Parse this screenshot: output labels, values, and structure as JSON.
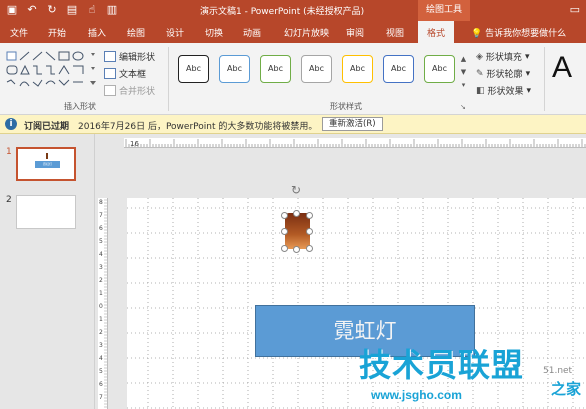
{
  "titlebar": {
    "title": "演示文稿1 - PowerPoint (未经授权产品)",
    "context_tab": "绘图工具",
    "qat": [
      "save-icon",
      "undo-icon",
      "redo-icon",
      "slideshow-icon",
      "touch-mode-icon",
      "layout-icon"
    ]
  },
  "tabs": [
    "文件",
    "开始",
    "插入",
    "绘图",
    "设计",
    "切换",
    "动画",
    "幻灯片放映",
    "审阅",
    "视图",
    "格式"
  ],
  "active_tab": "格式",
  "tell_me": "告诉我你想要做什么",
  "ribbon": {
    "insert_shapes": {
      "label": "插入形状",
      "edit_shape": "编辑形状",
      "text_box": "文本框",
      "merge_shapes": "合并形状"
    },
    "shape_styles": {
      "label": "形状样式",
      "gallery": [
        "Abc",
        "Abc",
        "Abc",
        "Abc",
        "Abc",
        "Abc",
        "Abc"
      ],
      "gallery_border_colors": [
        "#222222",
        "#5b9bd5",
        "#70ad47",
        "#a5a5a5",
        "#ffc000",
        "#4472c4",
        "#70ad47"
      ],
      "fill": "形状填充",
      "outline": "形状轮廓",
      "effects": "形状效果"
    },
    "wordart_glyph": "A"
  },
  "message_bar": {
    "heading": "订阅已过期",
    "text": "2016年7月26日 后，PowerPoint 的大多数功能将被禁用。",
    "button": "重新激活(R)"
  },
  "slides": [
    {
      "number": "1",
      "selected": true,
      "mini_label": "霓虹灯"
    },
    {
      "number": "2",
      "selected": false
    }
  ],
  "ruler_labels": {
    "horizontal": "16",
    "vertical": [
      "8",
      "7",
      "6",
      "5",
      "4",
      "3",
      "2",
      "1",
      "0",
      "1",
      "2",
      "3",
      "4",
      "5",
      "6",
      "7"
    ]
  },
  "slide": {
    "box_text": "霓虹灯",
    "box_color": "#5b9bd5"
  },
  "watermark": {
    "title": "技术员联盟",
    "ext": "51.net",
    "suffix": "之家",
    "url": "www.jsgho.com"
  }
}
